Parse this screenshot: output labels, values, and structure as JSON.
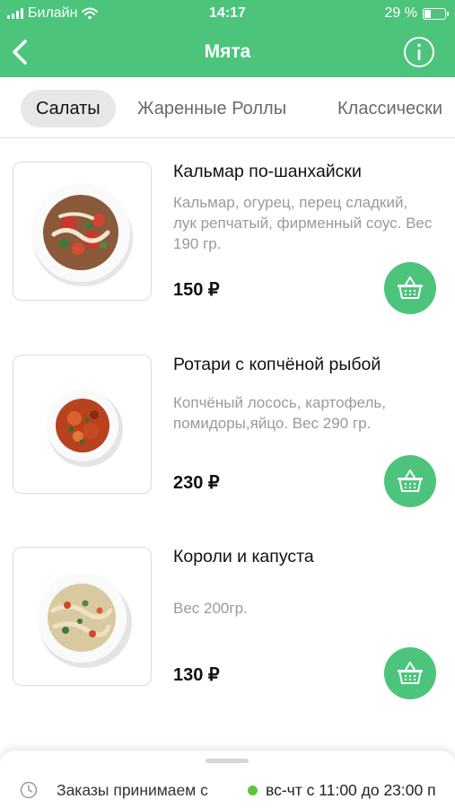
{
  "status_bar": {
    "carrier": "Билайн",
    "time": "14:17",
    "battery": "29 %",
    "battery_level": 0.29
  },
  "nav": {
    "title": "Мята",
    "back_icon": "chevron-left-icon",
    "info_icon": "info-icon"
  },
  "tabs": [
    {
      "label": "Салаты",
      "active": true
    },
    {
      "label": "Жаренные Роллы",
      "active": false
    },
    {
      "label": "Классически",
      "active": false
    }
  ],
  "items": [
    {
      "title": "Кальмар по-шанхайски",
      "description": "Кальмар, огурец, перец сладкий, лук репчатый, фирменный соус. Вес 190 гр.",
      "price": "150 ₽"
    },
    {
      "title": "Ротари с копчёной рыбой",
      "description": "Копчёный лосось, картофель, помидоры,яйцо. Вес 290 гр.",
      "price": "230 ₽"
    },
    {
      "title": "Короли и капуста",
      "description": "Вес 200гр.",
      "price": "130 ₽"
    }
  ],
  "footer": {
    "orders_label": "Заказы принимаем с",
    "hours": "вс-чт с 11:00 до 23:00 п",
    "status_color": "#5cc63c"
  },
  "colors": {
    "brand_green": "#4cc47c",
    "active_tab_bg": "#e7e7e7",
    "muted_text": "#9a9a9a"
  }
}
